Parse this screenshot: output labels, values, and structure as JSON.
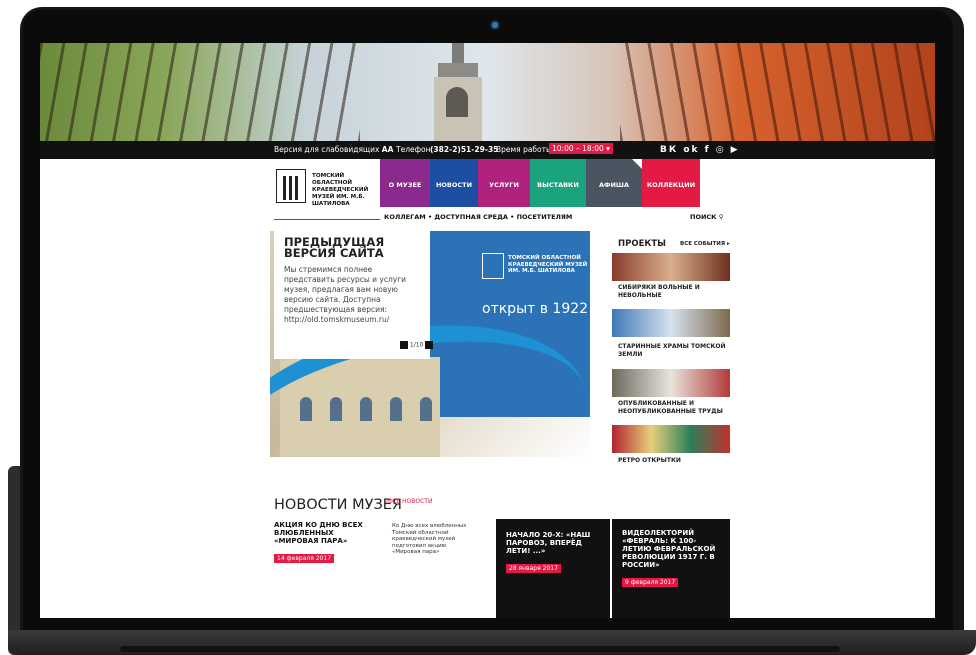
{
  "topbar": {
    "accessibility": "Версия для слабовидящих",
    "accessibility_icon": "АА",
    "phone_label": "Телефон:",
    "phone": "(382-2)51-29-35",
    "hours_label": "Время работы:",
    "hours": "10:00 – 18:00 ▾",
    "social": "ВК ok f ◎ ▶"
  },
  "logo": {
    "text": "ТОМСКИЙ ОБЛАСТНОЙ КРАЕВЕДЧЕСКИЙ МУЗЕЙ ИМ. М.Б. ШАТИЛОВА"
  },
  "menu": [
    "О МУЗЕЕ",
    "НОВОСТИ",
    "УСЛУГИ",
    "ВЫСТАВКИ",
    "АФИША",
    "КОЛЛЕКЦИИ"
  ],
  "submenu": "КОЛЛЕГАМ • ДОСТУПНАЯ СРЕДА • ПОСЕТИТЕЛЯМ",
  "search_label": "ПОИСК",
  "hero": {
    "title": "ПРЕДЫДУЩАЯ ВЕРСИЯ САЙТА",
    "text": "Мы стремимся полнее представить ресурсы и услуги музея, предлагая вам новую версию сайта. Доступна предшествующая версия: http://old.tomskmuseum.ru/",
    "pager": "1/10",
    "logo_text": "ТОМСКИЙ ОБЛАСТНОЙ КРАЕВЕДЧЕСКИЙ МУЗЕЙ ИМ. М.Б. ШАТИЛОВА",
    "founded": "открыт в 1922 г."
  },
  "projects": {
    "title": "ПРОЕКТЫ",
    "all_events": "ВСЕ СОБЫТИЯ ▸",
    "items": [
      "СИБИРЯКИ ВОЛЬНЫЕ И НЕВОЛЬНЫЕ",
      "СТАРИННЫЕ ХРАМЫ ТОМСКОЙ ЗЕМЛИ",
      "ОПУБЛИКОВАННЫЕ И НЕОПУБЛИКОВАННЫЕ ТРУДЫ",
      "РЕТРО ОТКРЫТКИ"
    ]
  },
  "news": {
    "title": "НОВОСТИ МУЗЕЯ",
    "all": "/ВСЕ НОВОСТИ",
    "items": [
      {
        "title": "АКЦИЯ КО ДНЮ ВСЕХ ВЛЮБЛЕННЫХ «МИРОВАЯ ПАРА»",
        "date": "14 февраля 2017",
        "excerpt": "Ко Дню всех влюбленных Томский областной краеведческий музей подготовил акцию «Мировая пара»"
      },
      {
        "title": "НАЧАЛО 20-Х: «НАШ ПАРОВОЗ, ВПЕРЁД ЛЕТИ! ...»",
        "date": "28 января 2017"
      },
      {
        "title": "ВИДЕОЛЕКТОРИЙ «ФЕВРАЛЬ: К 100-ЛЕТИЮ ФЕВРАЛЬСКОЙ РЕВОЛЮЦИИ 1917 Г. В РОССИИ»",
        "date": "9 февраля 2017"
      }
    ]
  }
}
